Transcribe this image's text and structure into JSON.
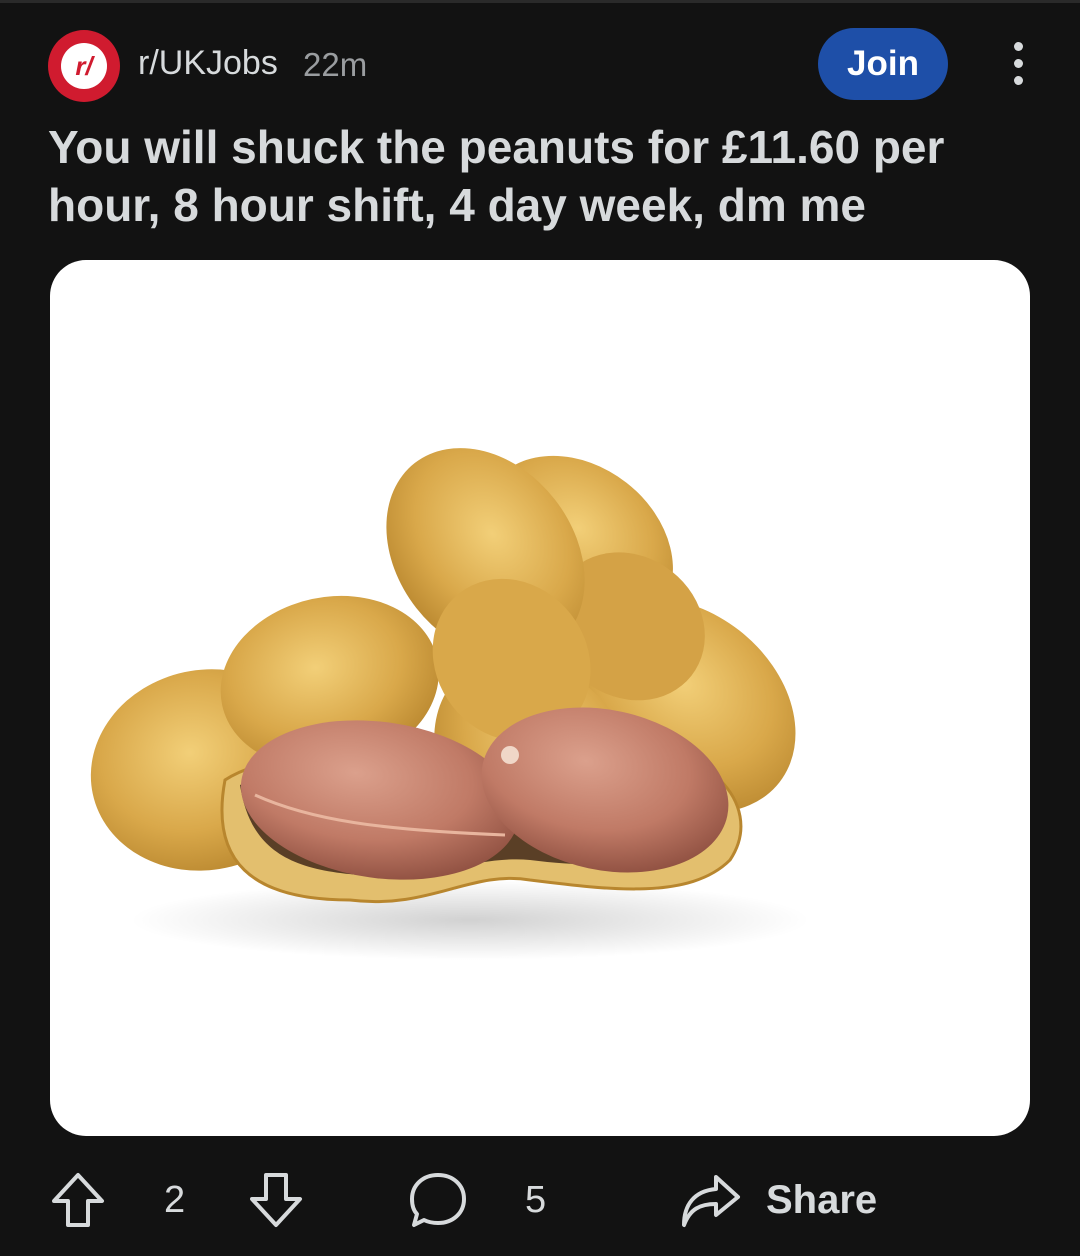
{
  "post": {
    "subreddit": "r/UKJobs",
    "time_ago": "22m",
    "avatar_text": "r/",
    "join_label": "Join",
    "title": "You will shuck the peanuts for £11.60 per hour, 8 hour shift, 4 day week, dm me"
  },
  "actions": {
    "upvotes": "2",
    "comments": "5",
    "share_label": "Share"
  },
  "icons": {
    "upvote": "arrow-up-icon",
    "downvote": "arrow-down-icon",
    "comment": "comment-bubble-icon",
    "share": "share-arrow-icon",
    "more": "more-vertical-icon"
  },
  "colors": {
    "background": "#121212",
    "join_button": "#1e4fa8",
    "avatar": "#d01b2f",
    "text": "#d7dadc",
    "muted": "#9a9da0"
  }
}
